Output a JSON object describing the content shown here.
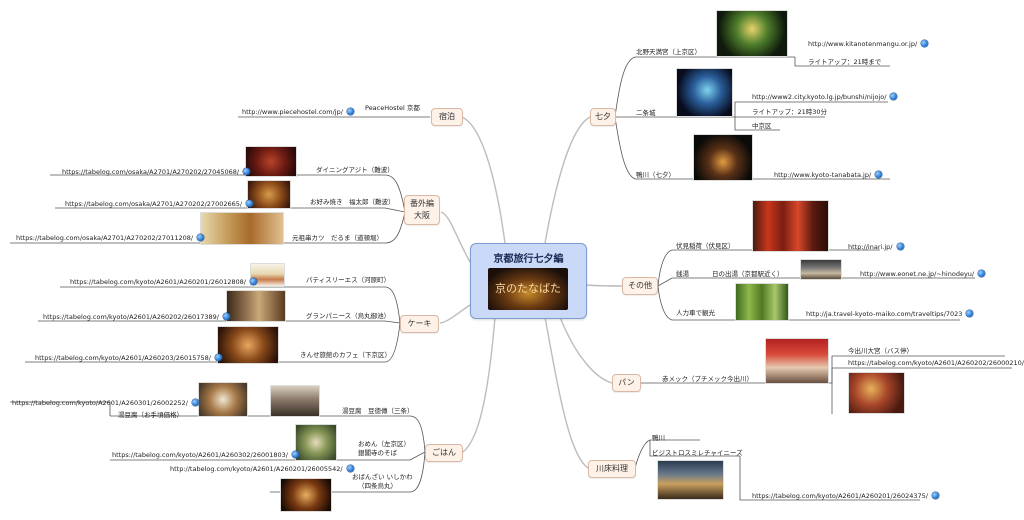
{
  "central": {
    "title": "京都旅行七夕編",
    "image_text": "京のたなばた"
  },
  "branches": {
    "tanabata": {
      "label": "七夕",
      "items": [
        {
          "name": "北野天満宮（上京区）",
          "url": "http://www.kitanotenmangu.or.jp/",
          "note": "ライトアップ：21時まで"
        },
        {
          "name": "二条城",
          "url": "http://www2.city.kyoto.lg.jp/bunshi/nijojo/",
          "note": "ライトアップ：21時30分",
          "note2": "中京区"
        },
        {
          "name": "鴨川（七夕）",
          "url": "http://www.kyoto-tanabata.jp/"
        }
      ]
    },
    "sonota": {
      "label": "その他",
      "items": [
        {
          "name": "伏見稲荷（伏見区）",
          "url": "http://inari.jp/"
        },
        {
          "name": "銭湯",
          "sub": "日の出湯（京都駅近く）",
          "url": "http://www.eonet.ne.jp/~hinodeyu/"
        },
        {
          "name": "人力車で観光",
          "url": "http://ja.travel-kyoto-maiko.com/traveltips/7023"
        }
      ]
    },
    "pan": {
      "label": "パン",
      "items": [
        {
          "name": "赤メック（プチメック今出川）",
          "sub": "今出川大宮（バス停）",
          "url": "https://tabelog.com/kyoto/A2601/A260202/26000210/"
        }
      ]
    },
    "kawadoko": {
      "label": "川床料理",
      "items": [
        {
          "name": "鴨川",
          "sub": "ビジストロスミレチャイニーズ",
          "url": "https://tabelog.com/kyoto/A2601/A260201/26024375/"
        }
      ]
    },
    "shukuhaku": {
      "label": "宿泊",
      "items": [
        {
          "name": "PeaceHostel 京都",
          "url": "http://www.piecehostel.com/jp/"
        }
      ]
    },
    "osaka": {
      "label": "番外編\n大阪",
      "label_line1": "番外編",
      "label_line2": "大阪",
      "items": [
        {
          "name": "ダイニングアジト（難波）",
          "url": "https://tabelog.com/osaka/A2701/A270202/27045068/"
        },
        {
          "name": "お好み焼き　福太郎（難波）",
          "url": "https://tabelog.com/osaka/A2701/A270202/27002665/"
        },
        {
          "name": "元祖串カツ　だるま（道頓堀）",
          "url": "https://tabelog.com/osaka/A2701/A270202/27011208/"
        }
      ]
    },
    "cake": {
      "label": "ケーキ",
      "items": [
        {
          "name": "パティスリーエス（河原町）",
          "url": "https://tabelog.com/kyoto/A2601/A260201/26012808/"
        },
        {
          "name": "グランパニース（烏丸御池）",
          "url": "https://tabelog.com/kyoto/A2601/A260202/26017389/"
        },
        {
          "name": "きんせ旅館のカフェ（下京区）",
          "url": "https://tabelog.com/kyoto/A2601/A260203/26015758/"
        }
      ]
    },
    "gohan": {
      "label": "ごはん",
      "items": [
        {
          "name": "湯豆腐　豆徳傳（三条）",
          "url": "https://tabelog.com/kyoto/A2601/A260301/26002252/",
          "note": "湯豆腐（お手頃価格）"
        },
        {
          "name": "おめん（左京区）",
          "sub": "銀閣寺のそば",
          "url": "https://tabelog.com/kyoto/A2601/A260302/26001803/"
        },
        {
          "name": "おばんざい いしかわ",
          "sub": "（四条烏丸）",
          "url": "http://tabelog.com/kyoto/A2601/A260201/26005542/"
        }
      ]
    }
  },
  "colors": {
    "central_fill": "#c9d9f7",
    "branch_fill": "#fdf1e8",
    "connector": "#b9b9b9",
    "globe": "#2f7fd6"
  }
}
